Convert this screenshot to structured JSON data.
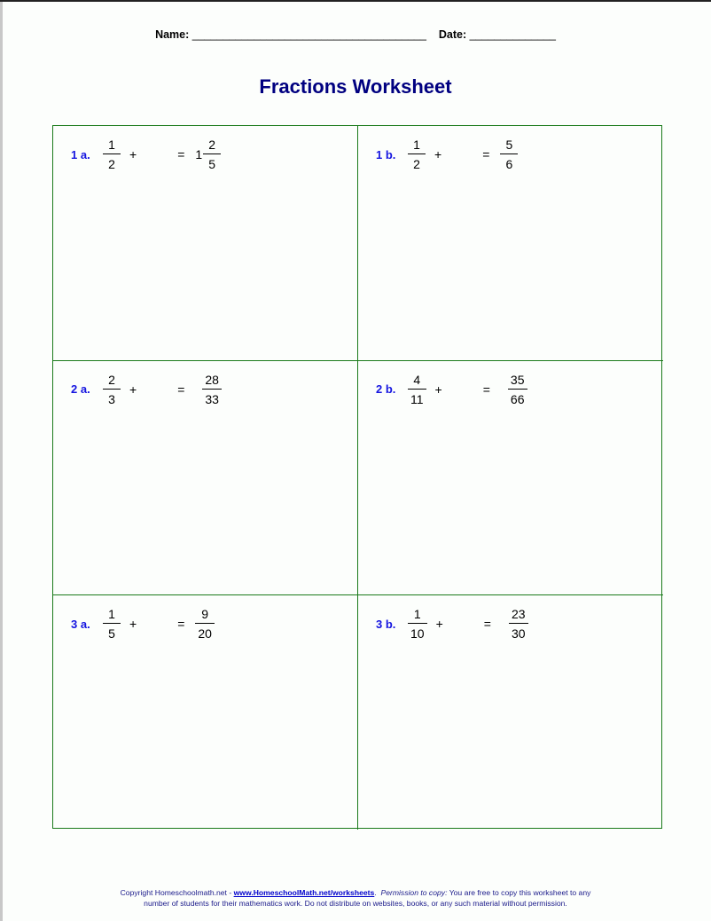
{
  "header": {
    "name_label": "Name:",
    "name_blank": "______________________________________",
    "date_label": "Date:",
    "date_blank": "______________"
  },
  "title": "Fractions Worksheet",
  "problems": [
    {
      "label": "1 a.",
      "addend": {
        "num": "1",
        "den": "2"
      },
      "op": "+",
      "eq": "=",
      "result": {
        "whole": "1",
        "num": "2",
        "den": "5"
      }
    },
    {
      "label": "1 b.",
      "addend": {
        "num": "1",
        "den": "2"
      },
      "op": "+",
      "eq": "=",
      "result": {
        "whole": "",
        "num": "5",
        "den": "6"
      }
    },
    {
      "label": "2 a.",
      "addend": {
        "num": "2",
        "den": "3"
      },
      "op": "+",
      "eq": "=",
      "result": {
        "whole": "",
        "num": "28",
        "den": "33"
      }
    },
    {
      "label": "2 b.",
      "addend": {
        "num": "4",
        "den": "11"
      },
      "op": "+",
      "eq": "=",
      "result": {
        "whole": "",
        "num": "35",
        "den": "66"
      }
    },
    {
      "label": "3 a.",
      "addend": {
        "num": "1",
        "den": "5"
      },
      "op": "+",
      "eq": "=",
      "result": {
        "whole": "",
        "num": "9",
        "den": "20"
      }
    },
    {
      "label": "3 b.",
      "addend": {
        "num": "1",
        "den": "10"
      },
      "op": "+",
      "eq": "=",
      "result": {
        "whole": "",
        "num": "23",
        "den": "30"
      }
    }
  ],
  "footer": {
    "copyright": "Copyright Homeschoolmath.net - ",
    "link": "www.HomeschoolMath.net/worksheets",
    "period": ".",
    "permission_label": "Permission to copy:",
    "permission_text": " You are free to copy this worksheet to any",
    "line2": "number of students for their mathematics work. Do not distribute on websites, books, or any such material without permission."
  },
  "colors": {
    "title": "#000080",
    "label": "#1515e0",
    "grid": "#1a7a1a"
  }
}
